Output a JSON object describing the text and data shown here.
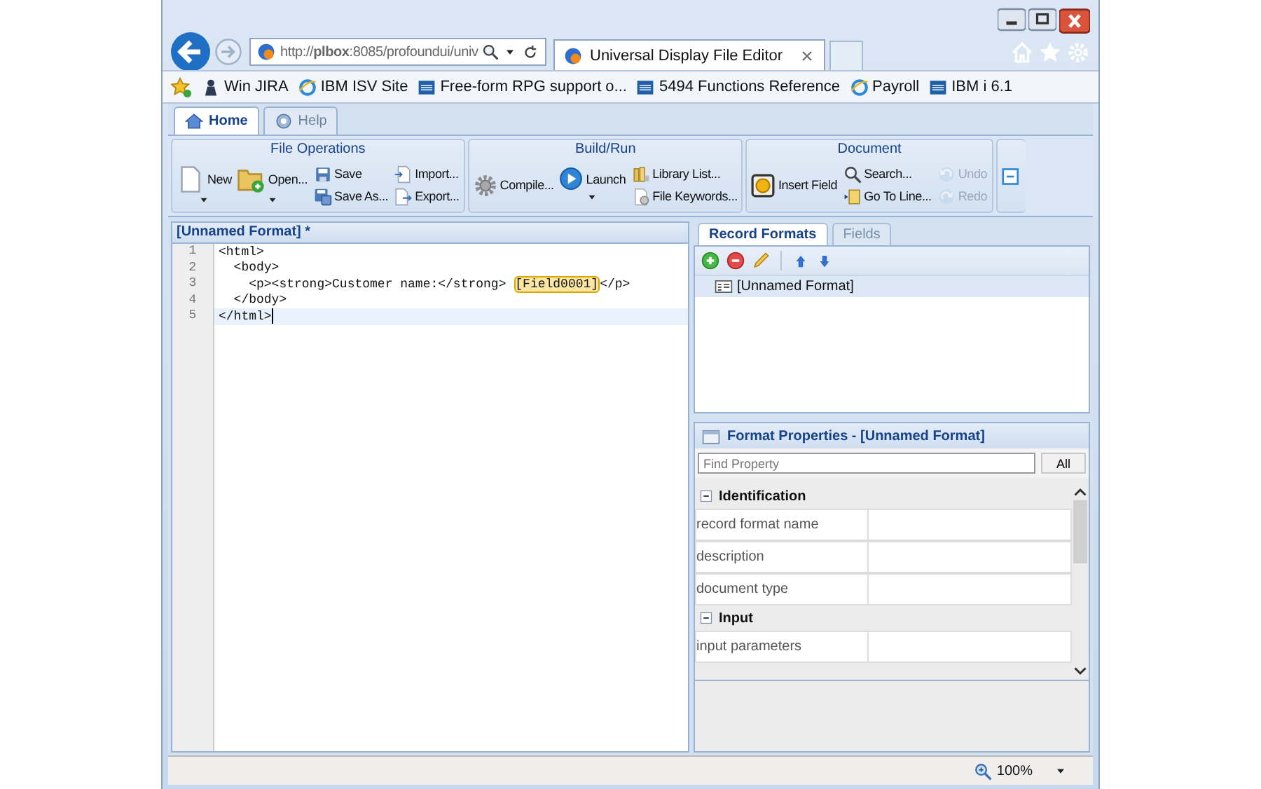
{
  "browser": {
    "address": "http://**plbox**:8085/profoundui/univ",
    "tabs": [
      {
        "title": "Universal Display File Editor",
        "selected": true
      }
    ],
    "favorites": [
      {
        "label": "Win JIRA"
      },
      {
        "label": "IBM ISV Site"
      },
      {
        "label": "Free-form RPG support o..."
      },
      {
        "label": "5494 Functions Reference"
      },
      {
        "label": "Payroll"
      },
      {
        "label": "IBM i 6.1"
      }
    ]
  },
  "app_tabs": [
    {
      "label": "Home",
      "selected": true
    },
    {
      "label": "Help",
      "selected": false
    }
  ],
  "ribbon": {
    "groups": [
      {
        "title": "File Operations",
        "columns": [
          {
            "kind": "large",
            "items": [
              {
                "label": "New",
                "dropdown": true,
                "disabled": false
              }
            ]
          },
          {
            "kind": "large",
            "items": [
              {
                "label": "Open...",
                "dropdown": true,
                "disabled": false
              }
            ]
          },
          {
            "kind": "small",
            "items": [
              {
                "label": "Save",
                "dropdown": false,
                "disabled": false
              },
              {
                "label": "Save As...",
                "dropdown": false,
                "disabled": false
              }
            ]
          },
          {
            "kind": "small",
            "items": [
              {
                "label": "Import...",
                "dropdown": false,
                "disabled": false
              },
              {
                "label": "Export...",
                "dropdown": false,
                "disabled": false
              }
            ]
          }
        ]
      },
      {
        "title": "Build/Run",
        "columns": [
          {
            "kind": "medium",
            "items": [
              {
                "label": "Compile...",
                "dropdown": false,
                "disabled": false
              }
            ]
          },
          {
            "kind": "medium",
            "items": [
              {
                "label": "Launch",
                "dropdown": true,
                "disabled": false
              }
            ]
          },
          {
            "kind": "small",
            "items": [
              {
                "label": "Library List...",
                "dropdown": false,
                "disabled": false
              },
              {
                "label": "File Keywords...",
                "dropdown": false,
                "disabled": false
              }
            ]
          }
        ]
      },
      {
        "title": "Document",
        "columns": [
          {
            "kind": "medium",
            "items": [
              {
                "label": "Insert Field",
                "dropdown": false,
                "disabled": false
              }
            ]
          },
          {
            "kind": "small",
            "items": [
              {
                "label": "Search...",
                "dropdown": false,
                "disabled": false
              },
              {
                "label": "Go To Line...",
                "dropdown": false,
                "disabled": false
              }
            ]
          },
          {
            "kind": "small",
            "items": [
              {
                "label": "Undo",
                "dropdown": false,
                "disabled": true
              },
              {
                "label": "Redo",
                "dropdown": false,
                "disabled": true
              }
            ]
          }
        ]
      }
    ]
  },
  "editor": {
    "title": "[Unnamed Format] *",
    "lines": [
      {
        "number": "1",
        "current": false,
        "parts": [
          {
            "kind": "code",
            "text": "<html>"
          }
        ]
      },
      {
        "number": "2",
        "current": false,
        "parts": [
          {
            "kind": "code",
            "text": "  <body>"
          }
        ]
      },
      {
        "number": "3",
        "current": false,
        "parts": [
          {
            "kind": "code",
            "text": "    <p><strong>Customer name:</strong> "
          },
          {
            "kind": "field",
            "text": "[Field0001]"
          },
          {
            "kind": "code",
            "text": "</p>"
          }
        ]
      },
      {
        "number": "4",
        "current": false,
        "parts": [
          {
            "kind": "code",
            "text": "  </body>"
          }
        ]
      },
      {
        "number": "5",
        "current": true,
        "parts": [
          {
            "kind": "code",
            "text": "</html>"
          }
        ]
      }
    ]
  },
  "side_tabs": [
    {
      "label": "Record Formats",
      "selected": true
    },
    {
      "label": "Fields",
      "selected": false
    }
  ],
  "record_formats": [
    {
      "label": "[Unnamed Format]",
      "selected": true
    }
  ],
  "properties": {
    "title": "Format Properties - [Unnamed Format]",
    "placeholder": "Find Property",
    "filter_button": "All",
    "sections": [
      {
        "title": "Identification",
        "expanded": true,
        "rows": [
          {
            "name": "record format name"
          },
          {
            "name": "description"
          },
          {
            "name": "document type"
          }
        ]
      },
      {
        "title": "Input",
        "expanded": true,
        "rows": [
          {
            "name": "input parameters"
          }
        ]
      }
    ]
  },
  "status_bar": {
    "zoom": "100%"
  }
}
